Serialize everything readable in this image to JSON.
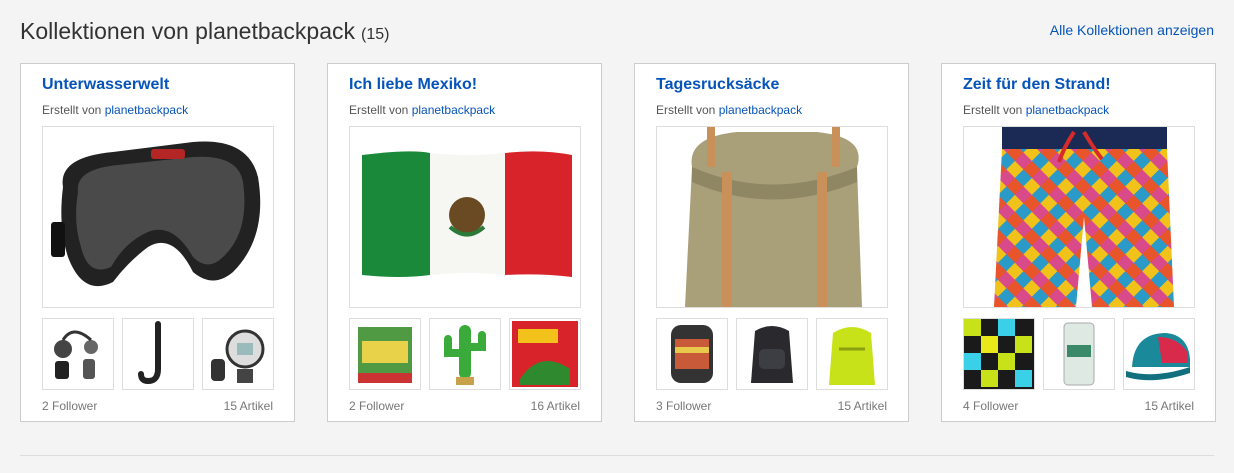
{
  "header": {
    "title": "Kollektionen von planetbackpack",
    "count": "(15)",
    "show_all": "Alle Kollektionen anzeigen"
  },
  "created_by_prefix": "Erstellt von",
  "collections": [
    {
      "title": "Unterwasserwelt",
      "author": "planetbackpack",
      "followers": "2 Follower",
      "articles": "15 Artikel"
    },
    {
      "title": "Ich liebe Mexiko!",
      "author": "planetbackpack",
      "followers": "2 Follower",
      "articles": "16 Artikel"
    },
    {
      "title": "Tagesrucksäcke",
      "author": "planetbackpack",
      "followers": "3 Follower",
      "articles": "15 Artikel"
    },
    {
      "title": "Zeit für den Strand!",
      "author": "planetbackpack",
      "followers": "4 Follower",
      "articles": "15 Artikel"
    }
  ],
  "colors": {
    "link": "#0654ba",
    "mexico_green": "#1a8a3a",
    "mexico_red": "#d8232a",
    "backpack": "#a9a07a"
  }
}
